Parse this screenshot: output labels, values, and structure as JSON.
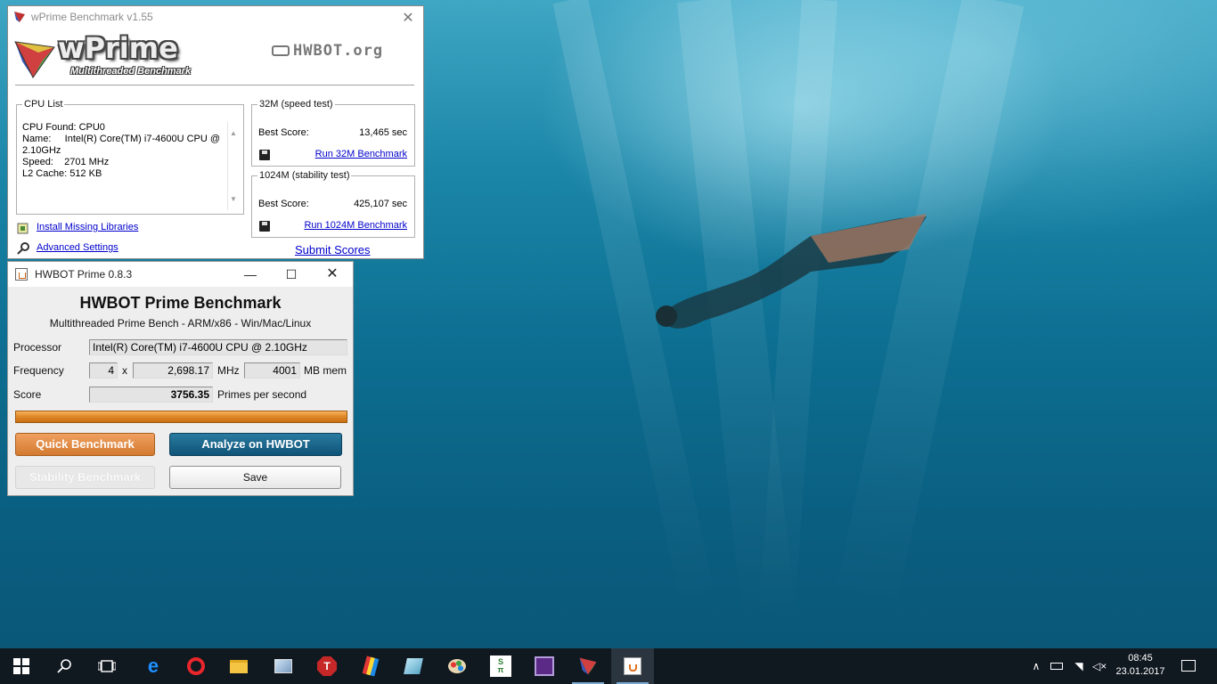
{
  "wprime": {
    "title": "wPrime Benchmark v1.55",
    "brand": "wPrime",
    "brand_sub": "Multithreaded Benchmark",
    "hwbot_logo": "HWBOT.org",
    "cpu_list": {
      "legend": "CPU List",
      "line1": "CPU Found: CPU0",
      "line2": "Name:     Intel(R) Core(TM) i7-4600U CPU @",
      "line3": "2.10GHz",
      "line4": "Speed:    2701 MHz",
      "line5": "L2 Cache: 512 KB"
    },
    "speed_test": {
      "legend": "32M (speed test)",
      "best_label": "Best Score:",
      "best_value": "13,465 sec",
      "run_link": "Run 32M Benchmark"
    },
    "stability_test": {
      "legend": "1024M (stability test)",
      "best_label": "Best Score:",
      "best_value": "425,107 sec",
      "run_link": "Run 1024M Benchmark"
    },
    "install_link": "Install Missing Libraries",
    "advanced_link": "Advanced Settings",
    "submit_link": "Submit Scores"
  },
  "hwbot_prime": {
    "title": "HWBOT Prime 0.8.3",
    "heading": "HWBOT Prime Benchmark",
    "subheading": "Multithreaded Prime Bench - ARM/x86 - Win/Mac/Linux",
    "processor_label": "Processor",
    "processor_value": "Intel(R) Core(TM) i7-4600U CPU @ 2.10GHz",
    "frequency_label": "Frequency",
    "cores": "4",
    "times": "x",
    "mhz_value": "2,698.17",
    "mhz_unit": "MHz",
    "mem_value": "4001",
    "mem_unit": "MB mem",
    "score_label": "Score",
    "score_value": "3756.35",
    "score_unit": "Primes per second",
    "progress": 1.0,
    "quick_button": "Quick Benchmark",
    "analyze_button": "Analyze on HWBOT",
    "stability_button": "Stability Benchmark",
    "save_button": "Save"
  },
  "taskbar": {
    "clock_time": "08:45",
    "clock_date": "23.01.2017",
    "items": [
      "start-icon",
      "search-icon",
      "task-view-icon",
      "edge-icon",
      "opera-icon",
      "file-explorer-icon",
      "control-panel-icon",
      "t-app-icon",
      "paint-tools-icon",
      "notes-icon",
      "paint-palette-icon",
      "superpi-icon",
      "cpu-z-icon",
      "wprime-icon",
      "java-icon"
    ]
  },
  "colors": {
    "accent_orange": "#e08a2a",
    "accent_blue": "#0f5478",
    "link_blue": "#0000cc"
  }
}
